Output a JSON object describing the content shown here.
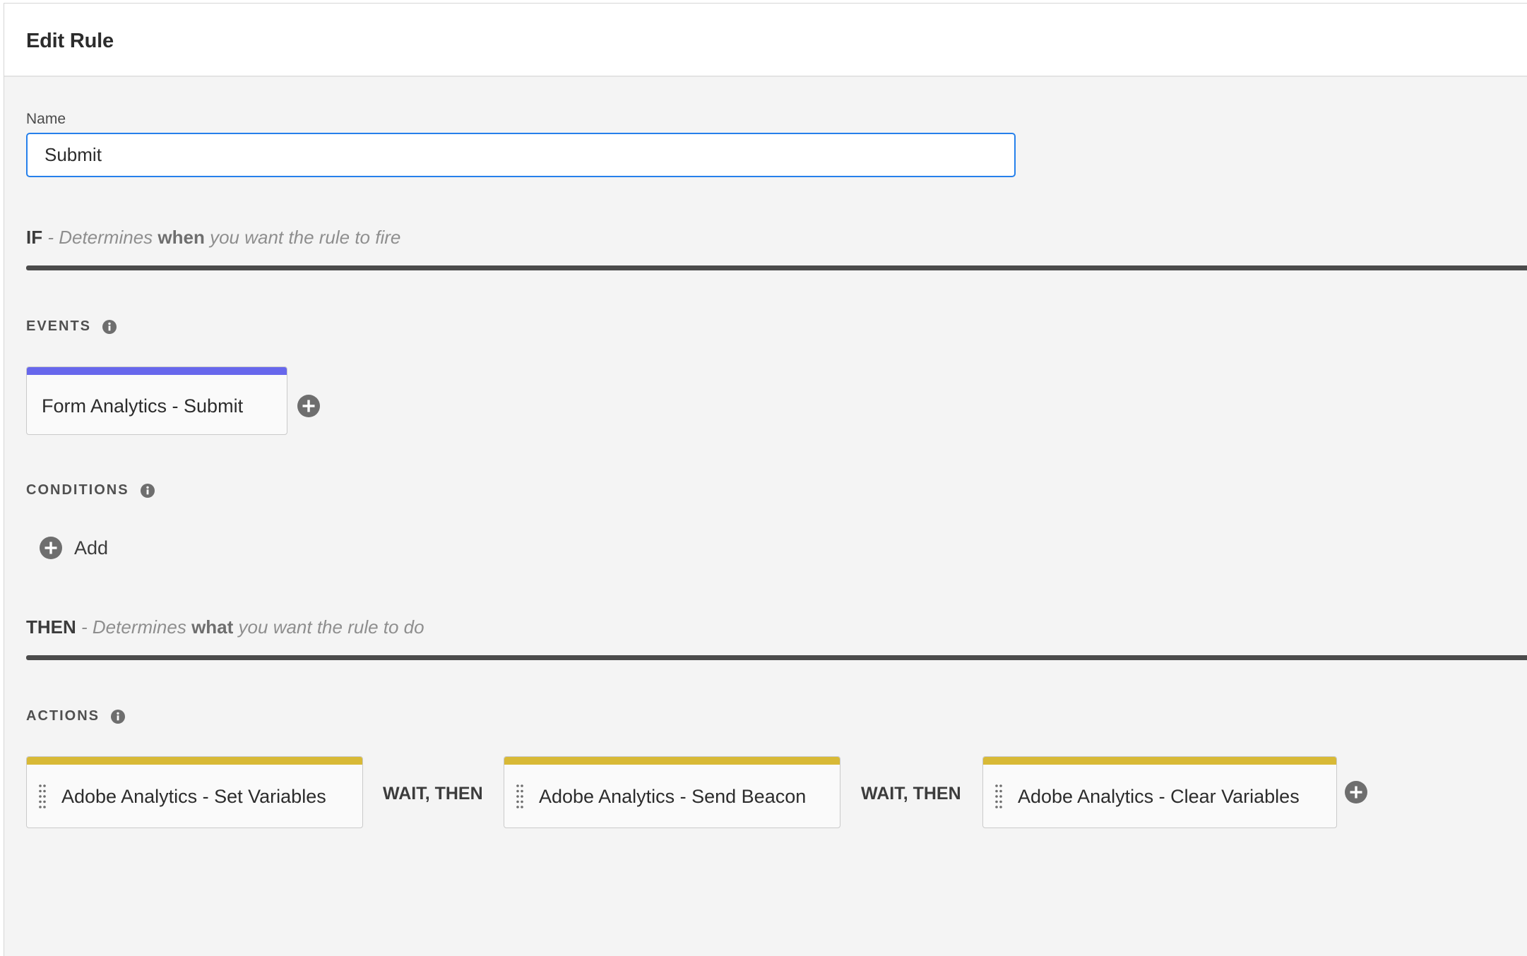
{
  "header": {
    "title": "Edit Rule"
  },
  "name_field": {
    "label": "Name",
    "value": "Submit"
  },
  "if_section": {
    "keyword": "IF",
    "desc_prefix": "- Determines",
    "desc_emphasis": "when",
    "desc_suffix": "you want the rule to fire"
  },
  "events": {
    "heading": "EVENTS",
    "items": [
      {
        "label": "Form Analytics - Submit"
      }
    ]
  },
  "conditions": {
    "heading": "CONDITIONS",
    "add_label": "Add"
  },
  "then_section": {
    "keyword": "THEN",
    "desc_prefix": "- Determines",
    "desc_emphasis": "what",
    "desc_suffix": "you want the rule to do"
  },
  "actions": {
    "heading": "ACTIONS",
    "items": [
      {
        "label": "Adobe Analytics - Set Variables"
      },
      {
        "label": "Adobe Analytics - Send Beacon"
      },
      {
        "label": "Adobe Analytics - Clear Variables"
      }
    ],
    "separator_label": "WAIT, THEN"
  },
  "icons": {
    "info": "info-icon",
    "add": "plus-circle-icon",
    "drag": "drag-handle-icon"
  },
  "colors": {
    "event_bar": "#6767ec",
    "action_bar": "#d8b936",
    "input_focus": "#2680eb",
    "rule_line": "#4b4b4b",
    "icon_gray": "#6e6e6e"
  }
}
